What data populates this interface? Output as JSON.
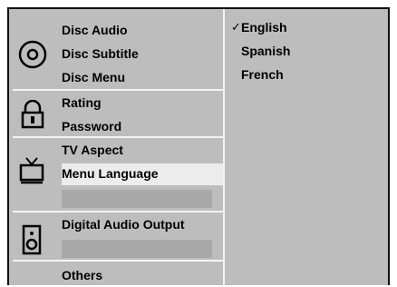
{
  "menu": {
    "disc": {
      "items": [
        "Disc Audio",
        "Disc Subtitle",
        "Disc Menu"
      ],
      "icon": "disc-icon"
    },
    "lock": {
      "items": [
        "Rating",
        "Password"
      ],
      "icon": "padlock-icon"
    },
    "tv": {
      "items": [
        "TV Aspect",
        "Menu Language"
      ],
      "icon": "tv-icon"
    },
    "audio": {
      "items": [
        "Digital Audio Output"
      ],
      "icon": "speaker-icon"
    },
    "others": {
      "items": [
        "Others"
      ]
    }
  },
  "options": {
    "check_mark": "✓",
    "items": [
      "English",
      "Spanish",
      "French"
    ],
    "selected": "English"
  }
}
